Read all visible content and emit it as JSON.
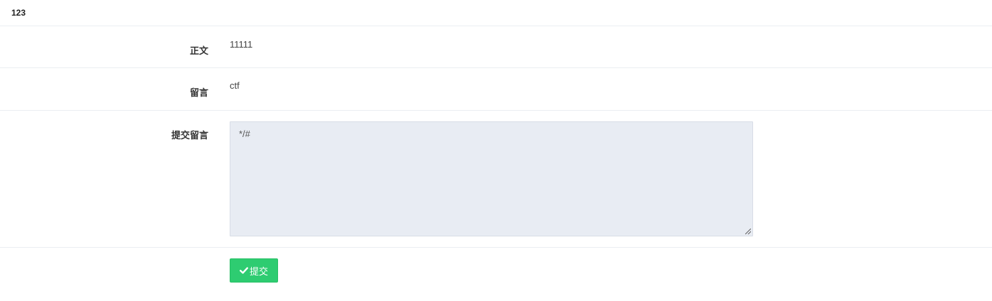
{
  "header": {
    "title": "123"
  },
  "form": {
    "body_label": "正文",
    "body_value": "11111",
    "comment_label": "留言",
    "comment_value": "ctf",
    "submit_comment_label": "提交留言",
    "textarea_value": "*/#",
    "submit_button_label": "提交",
    "submit_icon": "check-icon"
  },
  "colors": {
    "submit_button": "#2ecc71",
    "textarea_background": "#e8ecf3"
  }
}
